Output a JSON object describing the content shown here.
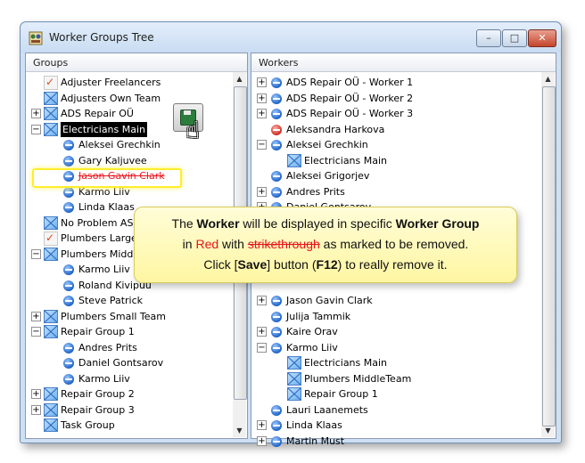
{
  "window": {
    "title": "Worker Groups Tree",
    "buttons": {
      "minimize": "–",
      "maximize": "□",
      "close": "✕"
    }
  },
  "left_pane": {
    "header": "Groups",
    "rows": [
      {
        "label": "Adjuster Freelancers",
        "icon": "check-icon",
        "expander": ""
      },
      {
        "label": "Adjusters Own Team",
        "icon": "group-icon",
        "expander": ""
      },
      {
        "label": "ADS Repair OÜ",
        "icon": "group-icon",
        "expander": "+"
      },
      {
        "label": "Electricians Main",
        "icon": "group-icon",
        "expander": "−",
        "selected": true
      },
      {
        "label": "Aleksei Grechkin",
        "icon": "person-icon",
        "expander": "",
        "indent": 1
      },
      {
        "label": "Gary Kaljuvee",
        "icon": "person-icon",
        "expander": "",
        "indent": 1
      },
      {
        "label": "Jason Gavin Clark",
        "icon": "person-icon",
        "expander": "",
        "indent": 1,
        "removed": true
      },
      {
        "label": "Karmo Liiv",
        "icon": "person-icon",
        "expander": "",
        "indent": 1
      },
      {
        "label": "Linda Klaas",
        "icon": "person-icon",
        "expander": "",
        "indent": 1
      },
      {
        "label": "No Problem AS",
        "icon": "group-icon",
        "expander": ""
      },
      {
        "label": "Plumbers Large",
        "icon": "check-icon",
        "expander": ""
      },
      {
        "label": "Plumbers Middle",
        "icon": "group-icon",
        "expander": "−"
      },
      {
        "label": "Karmo Liiv",
        "icon": "person-icon",
        "expander": "",
        "indent": 1
      },
      {
        "label": "Roland Kivipuu",
        "icon": "person-icon",
        "expander": "",
        "indent": 1
      },
      {
        "label": "Steve Patrick",
        "icon": "person-icon",
        "expander": "",
        "indent": 1
      },
      {
        "label": "Plumbers Small Team",
        "icon": "group-icon",
        "expander": "+"
      },
      {
        "label": "Repair Group 1",
        "icon": "group-icon",
        "expander": "−"
      },
      {
        "label": "Andres Prits",
        "icon": "person-icon",
        "expander": "",
        "indent": 1
      },
      {
        "label": "Daniel Gontsarov",
        "icon": "person-icon",
        "expander": "",
        "indent": 1
      },
      {
        "label": "Karmo Liiv",
        "icon": "person-icon",
        "expander": "",
        "indent": 1
      },
      {
        "label": "Repair Group 2",
        "icon": "group-icon",
        "expander": "+"
      },
      {
        "label": "Repair Group 3",
        "icon": "group-icon",
        "expander": "+"
      },
      {
        "label": "Task Group",
        "icon": "group-icon",
        "expander": ""
      }
    ]
  },
  "right_pane": {
    "header": "Workers",
    "rows": [
      {
        "label": "ADS Repair OÜ - Worker 1",
        "icon": "person-icon",
        "expander": "+"
      },
      {
        "label": "ADS Repair OÜ - Worker 2",
        "icon": "person-icon",
        "expander": "+"
      },
      {
        "label": "ADS Repair OÜ - Worker 3",
        "icon": "person-icon",
        "expander": "+"
      },
      {
        "label": "Aleksandra Harkova",
        "icon": "person-red-icon",
        "expander": ""
      },
      {
        "label": "Aleksei Grechkin",
        "icon": "person-icon",
        "expander": "−"
      },
      {
        "label": "Electricians Main",
        "icon": "group-icon",
        "expander": "",
        "indent": 1
      },
      {
        "label": "Aleksei Grigorjev",
        "icon": "person-icon",
        "expander": ""
      },
      {
        "label": "Andres Prits",
        "icon": "person-icon",
        "expander": "+"
      },
      {
        "label": "Daniel Gontsarov",
        "icon": "person-icon",
        "expander": "+"
      },
      {
        "label": "",
        "icon": "",
        "expander": ""
      },
      {
        "label": "",
        "icon": "",
        "expander": ""
      },
      {
        "label": "",
        "icon": "",
        "expander": ""
      },
      {
        "label": "",
        "icon": "",
        "expander": ""
      },
      {
        "label": "",
        "icon": "",
        "expander": ""
      },
      {
        "label": "Jason Gavin Clark",
        "icon": "person-icon",
        "expander": "+"
      },
      {
        "label": "Julija Tammik",
        "icon": "person-icon",
        "expander": ""
      },
      {
        "label": "Kaire Orav",
        "icon": "person-icon",
        "expander": "+"
      },
      {
        "label": "Karmo Liiv",
        "icon": "person-icon",
        "expander": "−"
      },
      {
        "label": "Electricians Main",
        "icon": "group-icon",
        "expander": "",
        "indent": 1
      },
      {
        "label": "Plumbers MiddleTeam",
        "icon": "group-icon",
        "expander": "",
        "indent": 1
      },
      {
        "label": "Repair Group 1",
        "icon": "group-icon",
        "expander": "",
        "indent": 1
      },
      {
        "label": "Lauri Laanemets",
        "icon": "person-icon",
        "expander": ""
      },
      {
        "label": "Linda Klaas",
        "icon": "person-icon",
        "expander": "+"
      },
      {
        "label": "Martin Must",
        "icon": "person-icon",
        "expander": "+"
      }
    ]
  },
  "callout": {
    "line1_a": "The ",
    "line1_b": "Worker",
    "line1_c": " will be displayed in specific ",
    "line1_d": "Worker Group",
    "line2_a": "in ",
    "line2_b": "Red",
    "line2_c": " with ",
    "line2_d": "strikethrough",
    "line2_e": " as marked to be removed.",
    "line3_a": "Click [",
    "line3_b": "Save",
    "line3_c": "] button (",
    "line3_d": "F12",
    "line3_e": ") to really remove it."
  },
  "colors": {
    "removed": "#e8141b",
    "highlight": "#ffee2a",
    "callout_bg": "#fff6a2"
  }
}
